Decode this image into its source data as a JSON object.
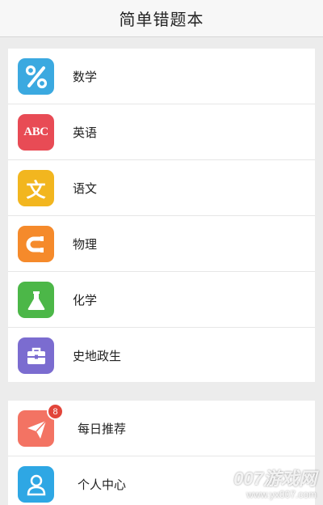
{
  "header": {
    "title": "简单错题本"
  },
  "subjects": [
    {
      "label": "数学",
      "icon": "percent-icon",
      "color": "#3ba9e0"
    },
    {
      "label": "英语",
      "icon": "abc-icon",
      "color": "#e84b55"
    },
    {
      "label": "语文",
      "icon": "wen-character-icon",
      "color": "#f2b61f"
    },
    {
      "label": "物理",
      "icon": "magnet-icon",
      "color": "#f58a2b"
    },
    {
      "label": "化学",
      "icon": "flask-icon",
      "color": "#4cb748"
    },
    {
      "label": "史地政生",
      "icon": "briefcase-icon",
      "color": "#7b6cd0"
    }
  ],
  "menu": [
    {
      "label": "每日推荐",
      "icon": "paper-plane-icon",
      "color": "#f37363",
      "badge": "8"
    },
    {
      "label": "个人中心",
      "icon": "person-icon",
      "color": "#2ea7e4"
    }
  ],
  "icon_text": {
    "abc": "ABC",
    "wen": "文"
  },
  "watermark": {
    "main": "007游戏网",
    "url": "www.yx007.com"
  }
}
